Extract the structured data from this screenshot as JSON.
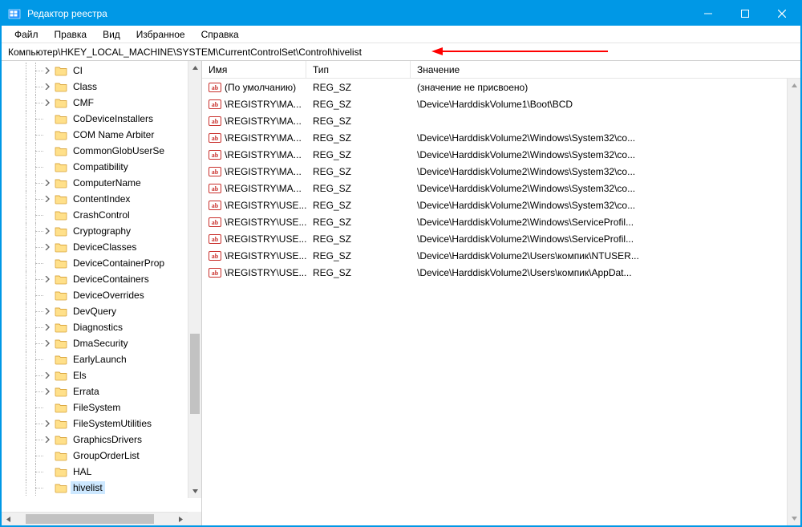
{
  "window": {
    "title": "Редактор реестра"
  },
  "menu": {
    "file": "Файл",
    "edit": "Правка",
    "view": "Вид",
    "favorites": "Избранное",
    "help": "Справка"
  },
  "address": {
    "path": "Компьютер\\HKEY_LOCAL_MACHINE\\SYSTEM\\CurrentControlSet\\Control\\hivelist"
  },
  "tree": {
    "items": [
      {
        "label": "CI",
        "expandable": true,
        "selected": false
      },
      {
        "label": "Class",
        "expandable": true,
        "selected": false
      },
      {
        "label": "CMF",
        "expandable": true,
        "selected": false
      },
      {
        "label": "CoDeviceInstallers",
        "expandable": false,
        "selected": false
      },
      {
        "label": "COM Name Arbiter",
        "expandable": false,
        "selected": false
      },
      {
        "label": "CommonGlobUserSe",
        "expandable": false,
        "selected": false
      },
      {
        "label": "Compatibility",
        "expandable": false,
        "selected": false
      },
      {
        "label": "ComputerName",
        "expandable": true,
        "selected": false
      },
      {
        "label": "ContentIndex",
        "expandable": true,
        "selected": false
      },
      {
        "label": "CrashControl",
        "expandable": false,
        "selected": false
      },
      {
        "label": "Cryptography",
        "expandable": true,
        "selected": false
      },
      {
        "label": "DeviceClasses",
        "expandable": true,
        "selected": false
      },
      {
        "label": "DeviceContainerProp",
        "expandable": false,
        "selected": false
      },
      {
        "label": "DeviceContainers",
        "expandable": true,
        "selected": false
      },
      {
        "label": "DeviceOverrides",
        "expandable": false,
        "selected": false
      },
      {
        "label": "DevQuery",
        "expandable": true,
        "selected": false
      },
      {
        "label": "Diagnostics",
        "expandable": true,
        "selected": false
      },
      {
        "label": "DmaSecurity",
        "expandable": true,
        "selected": false
      },
      {
        "label": "EarlyLaunch",
        "expandable": false,
        "selected": false
      },
      {
        "label": "Els",
        "expandable": true,
        "selected": false
      },
      {
        "label": "Errata",
        "expandable": true,
        "selected": false
      },
      {
        "label": "FileSystem",
        "expandable": false,
        "selected": false
      },
      {
        "label": "FileSystemUtilities",
        "expandable": true,
        "selected": false
      },
      {
        "label": "GraphicsDrivers",
        "expandable": true,
        "selected": false
      },
      {
        "label": "GroupOrderList",
        "expandable": false,
        "selected": false
      },
      {
        "label": "HAL",
        "expandable": false,
        "selected": false
      },
      {
        "label": "hivelist",
        "expandable": false,
        "selected": true
      }
    ]
  },
  "list": {
    "headers": {
      "name": "Имя",
      "type": "Тип",
      "value": "Значение"
    },
    "rows": [
      {
        "name": "(По умолчанию)",
        "type": "REG_SZ",
        "value": "(значение не присвоено)"
      },
      {
        "name": "\\REGISTRY\\MA...",
        "type": "REG_SZ",
        "value": "\\Device\\HarddiskVolume1\\Boot\\BCD"
      },
      {
        "name": "\\REGISTRY\\MA...",
        "type": "REG_SZ",
        "value": ""
      },
      {
        "name": "\\REGISTRY\\MA...",
        "type": "REG_SZ",
        "value": "\\Device\\HarddiskVolume2\\Windows\\System32\\co..."
      },
      {
        "name": "\\REGISTRY\\MA...",
        "type": "REG_SZ",
        "value": "\\Device\\HarddiskVolume2\\Windows\\System32\\co..."
      },
      {
        "name": "\\REGISTRY\\MA...",
        "type": "REG_SZ",
        "value": "\\Device\\HarddiskVolume2\\Windows\\System32\\co..."
      },
      {
        "name": "\\REGISTRY\\MA...",
        "type": "REG_SZ",
        "value": "\\Device\\HarddiskVolume2\\Windows\\System32\\co..."
      },
      {
        "name": "\\REGISTRY\\USE...",
        "type": "REG_SZ",
        "value": "\\Device\\HarddiskVolume2\\Windows\\System32\\co..."
      },
      {
        "name": "\\REGISTRY\\USE...",
        "type": "REG_SZ",
        "value": "\\Device\\HarddiskVolume2\\Windows\\ServiceProfil..."
      },
      {
        "name": "\\REGISTRY\\USE...",
        "type": "REG_SZ",
        "value": "\\Device\\HarddiskVolume2\\Windows\\ServiceProfil..."
      },
      {
        "name": "\\REGISTRY\\USE...",
        "type": "REG_SZ",
        "value": "\\Device\\HarddiskVolume2\\Users\\компик\\NTUSER..."
      },
      {
        "name": "\\REGISTRY\\USE...",
        "type": "REG_SZ",
        "value": "\\Device\\HarddiskVolume2\\Users\\компик\\AppDat..."
      }
    ]
  }
}
